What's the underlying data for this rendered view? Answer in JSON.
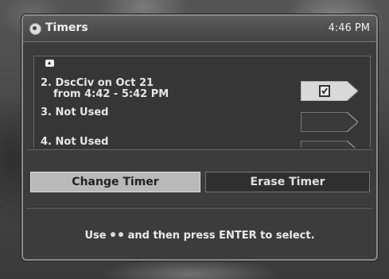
{
  "window": {
    "title": "Timers",
    "time": "4:46 PM"
  },
  "timers": [
    {
      "line1": "2. DscCiv on Oct 21",
      "line2": "from 4:42 - 5:42 PM",
      "status_icon": "check-box-icon"
    },
    {
      "line1": "3. Not Used",
      "line2": "",
      "status_icon": ""
    },
    {
      "line1": "4. Not Used",
      "line2": "",
      "status_icon": ""
    }
  ],
  "buttons": {
    "change": "Change Timer",
    "erase": "Erase Timer"
  },
  "help": {
    "prefix": "Use",
    "suffix": "and then press ENTER to select.",
    "icon": "arrows-icon"
  },
  "colors": {
    "panel": "#3c3c3c",
    "selected_button": "#b9b9b9",
    "text": "#e6e6e6"
  }
}
